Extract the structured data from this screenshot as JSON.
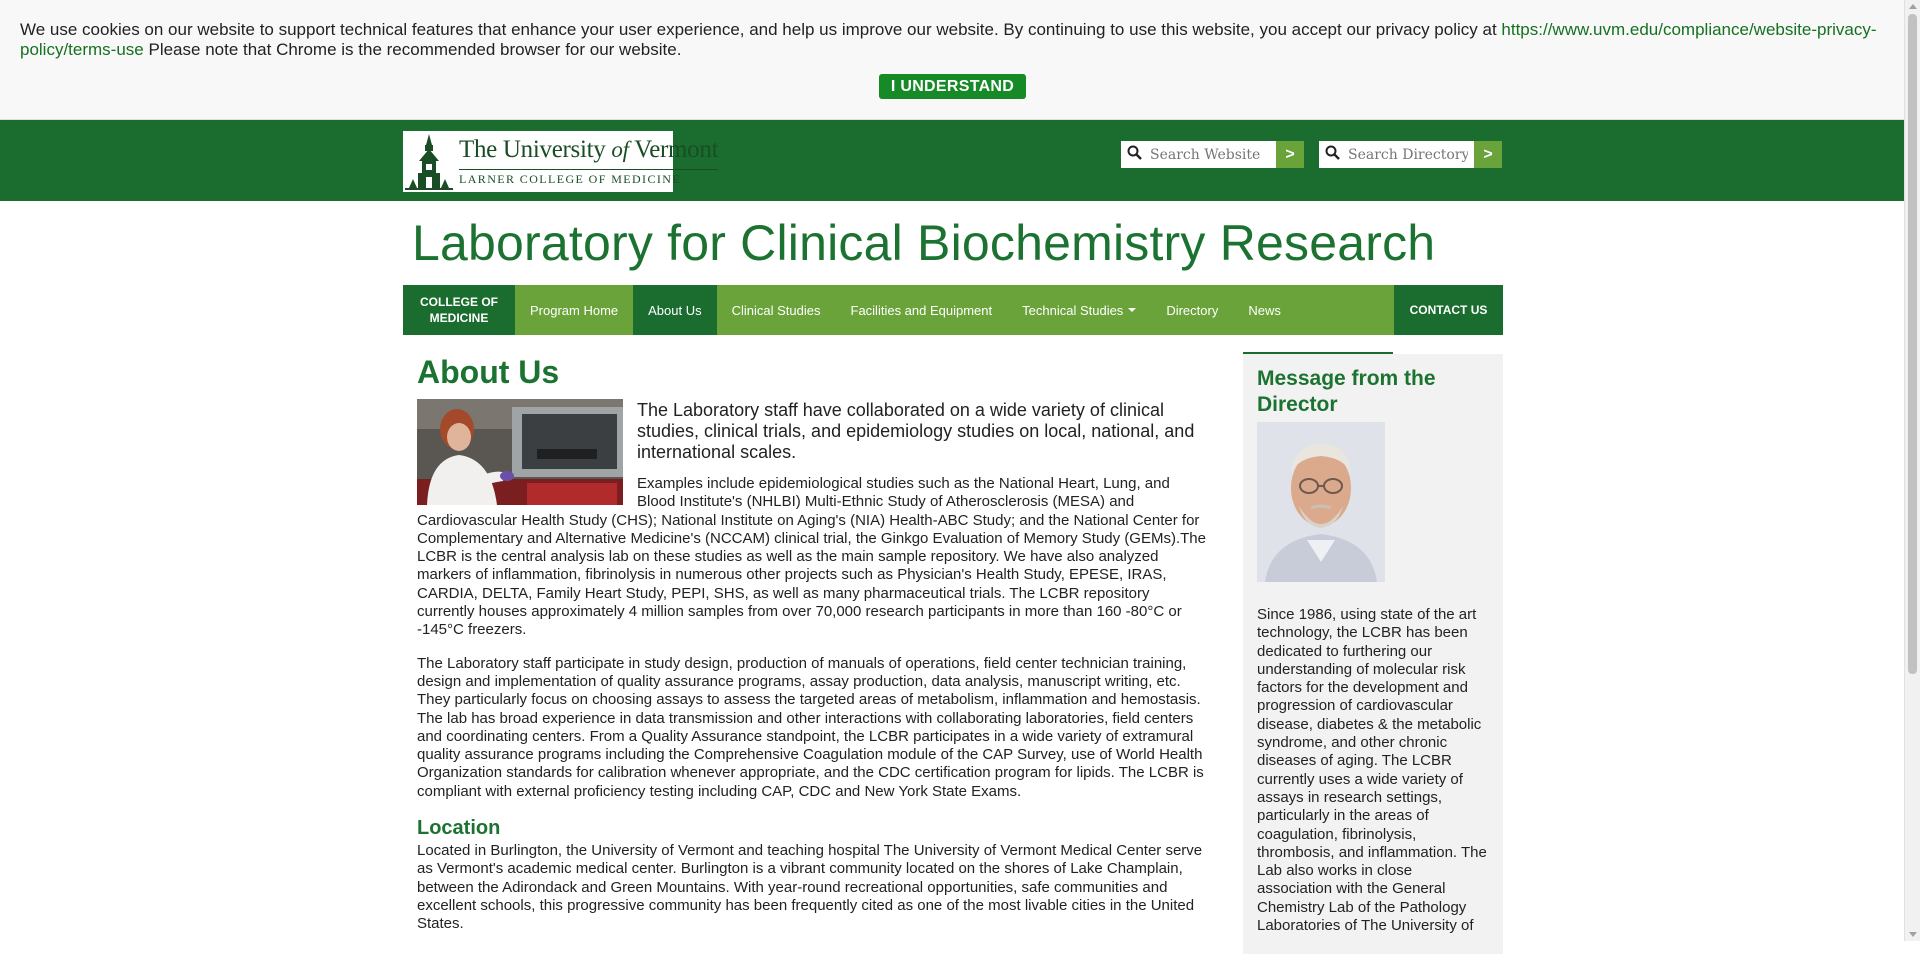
{
  "cookie_banner": {
    "text": "We use cookies on our website to support technical features that enhance your user experience, and help us improve our website. By continuing to use this website, you accept our privacy policy at ",
    "link": "https://www.uvm.edu/compliance/website-privacy-policy/terms-use",
    "note": " Please note that Chrome is the recommended browser for our website.",
    "button_label": "I UNDERSTAND"
  },
  "header": {
    "logo_line1": "The University",
    "logo_of": "of",
    "logo_line2": "Vermont",
    "logo_sub": "LARNER COLLEGE OF MEDICINE",
    "search_website_placeholder": "Search Website",
    "search_directory_placeholder": "Search Directory",
    "go_label": ">"
  },
  "site_title": "Laboratory for Clinical Biochemistry Research",
  "nav": {
    "college_label": "COLLEGE OF MEDICINE",
    "items": [
      {
        "label": "Program Home"
      },
      {
        "label": "About Us"
      },
      {
        "label": "Clinical Studies"
      },
      {
        "label": "Facilities and Equipment"
      },
      {
        "label": "Technical Studies"
      },
      {
        "label": "Directory"
      },
      {
        "label": "News"
      }
    ],
    "active": "About Us",
    "contact_label": "CONTACT US"
  },
  "main": {
    "heading": "About Us",
    "lead": "The Laboratory staff have collaborated on a wide variety of clinical studies, clinical trials, and epidemiology studies on local, national, and international scales.",
    "para1": "Examples include epidemiological studies such as the National Heart, Lung, and Blood Institute's (NHLBI) Multi-Ethnic Study of Atherosclerosis (MESA) and Cardiovascular Health Study (CHS); National Institute on Aging's (NIA) Health-ABC Study; and the National Center for Complementary and Alternative Medicine's (NCCAM) clinical trial, the Ginkgo Evaluation of Memory Study (GEMs).The LCBR is the central analysis lab on these studies as well as the main sample repository. We have also analyzed markers of inflammation, fibrinolysis in numerous other projects such as Physician's Health Study, EPESE, IRAS, CARDIA, DELTA, Family Heart Study, PEPI, SHS, as well as many pharmaceutical trials. The LCBR repository currently houses approximately 4 million samples from over 70,000 research participants in more than 160 -80°C or -145°C freezers.",
    "para2": "The Laboratory staff participate in study design, production of manuals of operations, field center technician training, design and implementation of quality assurance programs, assay production, data analysis, manuscript writing, etc. They particularly focus on choosing assays to assess the targeted areas of metabolism, inflammation and hemostasis. The lab has broad experience in data transmission and other interactions with collaborating laboratories, field centers and coordinating centers. From a Quality Assurance standpoint, the LCBR participates in a wide variety of extramural quality assurance programs including the Comprehensive Coagulation module of the CAP Survey, use of World Health Organization standards for calibration whenever appropriate, and the CDC certification program for lipids. The LCBR is compliant with external proficiency testing including CAP, CDC and New York State Exams.",
    "location_heading": "Location",
    "location_text": "Located in Burlington, the University of Vermont and teaching hospital The University of Vermont Medical Center serve as Vermont's academic medical center. Burlington is a vibrant community located on the shores of Lake Champlain, between the Adirondack and Green Mountains. With year-round recreational opportunities, safe communities and excellent schools, this progressive community has been frequently cited as one of the most livable cities in the United States."
  },
  "sidebar": {
    "heading": "Message from the Director",
    "text": "Since 1986, using state of the art technology, the LCBR has been dedicated to furthering our understanding of molecular risk factors for the development and progression of cardiovascular disease, diabetes & the metabolic syndrome, and other chronic diseases of aging. The LCBR currently uses a wide variety of assays in research settings, particularly in the areas of coagulation, fibrinolysis, thrombosis, and inflammation. The Lab also works in close association with the General Chemistry Lab of the Pathology Laboratories of The University of"
  },
  "colors": {
    "uvm_green": "#1a6d2e",
    "nav_green": "#6aa33a",
    "title_green": "#1c7331",
    "cookie_button": "#158a27"
  }
}
